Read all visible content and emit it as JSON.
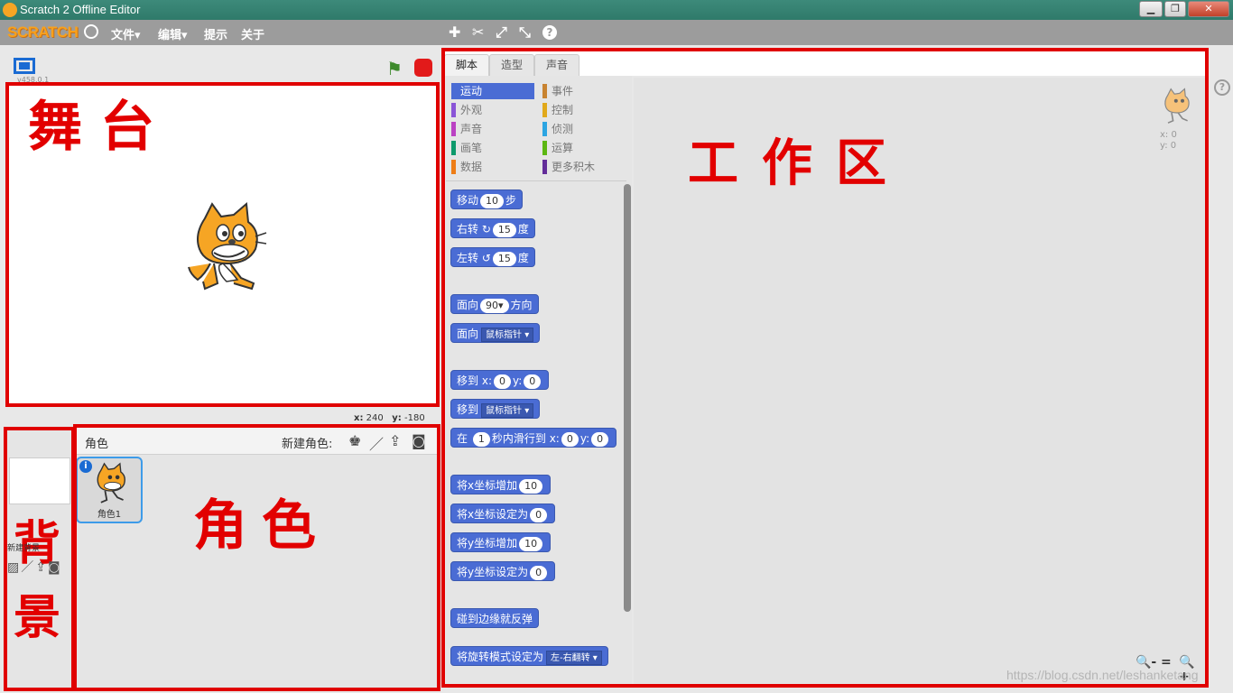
{
  "window": {
    "title": "Scratch 2 Offline Editor",
    "buttons": [
      "▁",
      "❐",
      "✕"
    ]
  },
  "menubar": {
    "logo": "SCRATCH",
    "items": [
      "文件▾",
      "编辑▾",
      "提示",
      "关于"
    ],
    "tools": [
      "✚",
      "✂",
      "⤢",
      "⤡",
      "?"
    ]
  },
  "stage": {
    "version": "v458.0.1",
    "coords": {
      "x_label": "x:",
      "x": "240",
      "y_label": "y:",
      "y": "-180"
    },
    "annotation": "舞台"
  },
  "backdrop": {
    "label": "新建背景",
    "annotation": "背景"
  },
  "sprites": {
    "title": "角色",
    "new_sprite_label": "新建角色:",
    "items": [
      {
        "name": "角色1",
        "info": "i"
      }
    ],
    "annotation": "角色"
  },
  "tabs": [
    "脚本",
    "造型",
    "声音"
  ],
  "categories": [
    {
      "label": "运动",
      "color": "#4a6cd4"
    },
    {
      "label": "外观",
      "color": "#8a55d7"
    },
    {
      "label": "声音",
      "color": "#bb42c3"
    },
    {
      "label": "画笔",
      "color": "#0e9a6c"
    },
    {
      "label": "数据",
      "color": "#ee7d16"
    },
    {
      "label": "事件",
      "color": "#c88330"
    },
    {
      "label": "控制",
      "color": "#e1a91a"
    },
    {
      "label": "侦测",
      "color": "#2ca5e2"
    },
    {
      "label": "运算",
      "color": "#5cb712"
    },
    {
      "label": "更多积木",
      "color": "#632d99"
    }
  ],
  "blocks": {
    "move": {
      "a": "移动",
      "v": "10",
      "b": "步"
    },
    "turn_right": {
      "a": "右转",
      "icon": "↻",
      "v": "15",
      "b": "度"
    },
    "turn_left": {
      "a": "左转",
      "icon": "↺",
      "v": "15",
      "b": "度"
    },
    "point_dir": {
      "a": "面向",
      "v": "90▾",
      "b": "方向"
    },
    "point_towards": {
      "a": "面向",
      "dd": "鼠标指针 ▾"
    },
    "goto_xy": {
      "a": "移到",
      "x": "x:",
      "xv": "0",
      "y": "y:",
      "yv": "0"
    },
    "goto": {
      "a": "移到",
      "dd": "鼠标指针 ▾"
    },
    "glide": {
      "a": "在",
      "v": "1",
      "b": "秒内滑行到",
      "x": "x:",
      "xv": "0",
      "y": "y:",
      "yv": "0"
    },
    "change_x": {
      "a": "将x坐标增加",
      "v": "10"
    },
    "set_x": {
      "a": "将x坐标设定为",
      "v": "0"
    },
    "change_y": {
      "a": "将y坐标增加",
      "v": "10"
    },
    "set_y": {
      "a": "将y坐标设定为",
      "v": "0"
    },
    "bounce": {
      "a": "碰到边缘就反弹"
    },
    "rotation_style": {
      "a": "将旋转模式设定为",
      "dd": "左-右翻转 ▾"
    }
  },
  "workspace": {
    "annotation": "工作区",
    "sprite_x": "x: 0",
    "sprite_y": "y: 0",
    "zoom": [
      "🔍-",
      "=",
      "🔍+"
    ],
    "help": "?"
  },
  "watermark": "https://blog.csdn.net/leshanketang",
  "colors": {
    "annotation_red": "#e00000",
    "motion_blue": "#4a6cd4"
  }
}
